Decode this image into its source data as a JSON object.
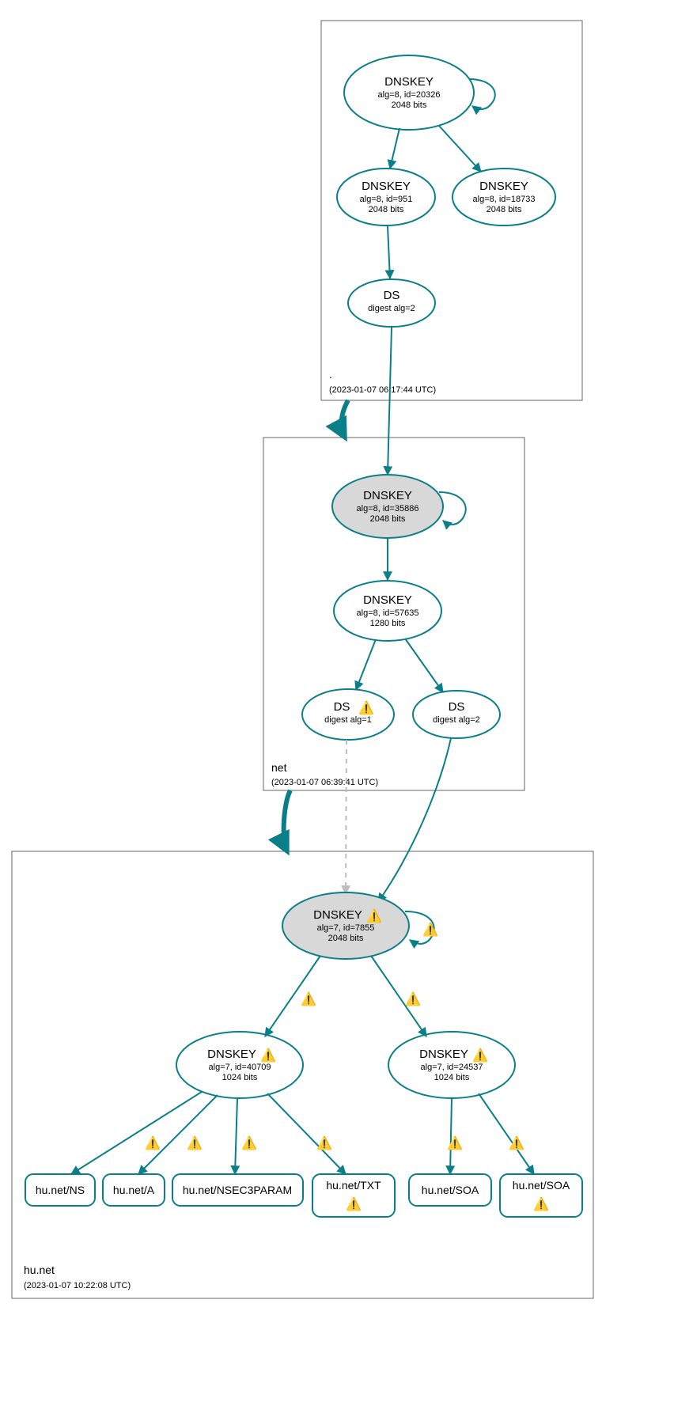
{
  "zones": {
    "root": {
      "name": ".",
      "timestamp": "(2023-01-07 06:17:44 UTC)"
    },
    "net": {
      "name": "net",
      "timestamp": "(2023-01-07 06:39:41 UTC)"
    },
    "hunet": {
      "name": "hu.net",
      "timestamp": "(2023-01-07 10:22:08 UTC)"
    }
  },
  "nodes": {
    "root_ksk": {
      "title": "DNSKEY",
      "sub1": "alg=8, id=20326",
      "sub2": "2048 bits"
    },
    "root_zsk1": {
      "title": "DNSKEY",
      "sub1": "alg=8, id=951",
      "sub2": "2048 bits"
    },
    "root_zsk2": {
      "title": "DNSKEY",
      "sub1": "alg=8, id=18733",
      "sub2": "2048 bits"
    },
    "root_ds": {
      "title": "DS",
      "sub1": "digest alg=2"
    },
    "net_ksk": {
      "title": "DNSKEY",
      "sub1": "alg=8, id=35886",
      "sub2": "2048 bits"
    },
    "net_zsk": {
      "title": "DNSKEY",
      "sub1": "alg=8, id=57635",
      "sub2": "1280 bits"
    },
    "net_ds1": {
      "title": "DS",
      "sub1": "digest alg=1"
    },
    "net_ds2": {
      "title": "DS",
      "sub1": "digest alg=2"
    },
    "hu_ksk": {
      "title": "DNSKEY",
      "sub1": "alg=7, id=7855",
      "sub2": "2048 bits"
    },
    "hu_zsk1": {
      "title": "DNSKEY",
      "sub1": "alg=7, id=40709",
      "sub2": "1024 bits"
    },
    "hu_zsk2": {
      "title": "DNSKEY",
      "sub1": "alg=7, id=24537",
      "sub2": "1024 bits"
    }
  },
  "records": {
    "ns": "hu.net/NS",
    "a": "hu.net/A",
    "nsec3": "hu.net/NSEC3PARAM",
    "txt": "hu.net/TXT",
    "soa1": "hu.net/SOA",
    "soa2": "hu.net/SOA"
  },
  "warning_glyph": "⚠️"
}
